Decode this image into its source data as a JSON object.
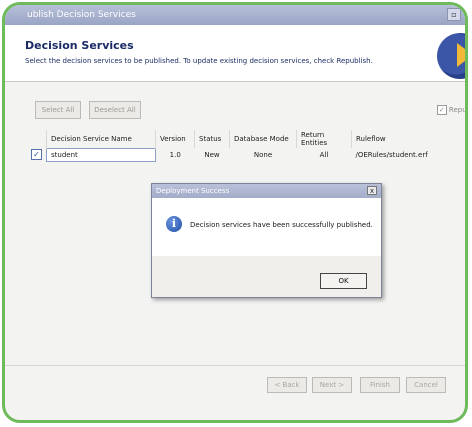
{
  "window": {
    "title": "ublish Decision Services",
    "maximize_glyph": "▫"
  },
  "header": {
    "title": "Decision Services",
    "description": "Select the decision services to be published.  To update existing decision services, check Republish."
  },
  "buttons": {
    "select_all": "Select All",
    "deselect_all": "Deselect All"
  },
  "republish": {
    "label": "Republi",
    "checked": true,
    "check_glyph": "✓"
  },
  "table": {
    "columns": [
      "Decision Service Name",
      "Version",
      "Status",
      "Database Mode",
      "Return Entities",
      "Ruleflow"
    ],
    "rows": [
      {
        "checked": true,
        "check_glyph": "✓",
        "name": "student",
        "version": "1.0",
        "status": "New",
        "database_mode": "None",
        "return_entities": "All",
        "ruleflow": "/OERules/student.erf"
      }
    ]
  },
  "dialog": {
    "title": "Deployment Success",
    "close_glyph": "x",
    "icon_glyph": "i",
    "message": "Decision services have been successfully published.",
    "ok_label": "OK"
  },
  "footer": {
    "back": "< Back",
    "next": "Next >",
    "finish": "Finish",
    "cancel": "Cancel"
  }
}
